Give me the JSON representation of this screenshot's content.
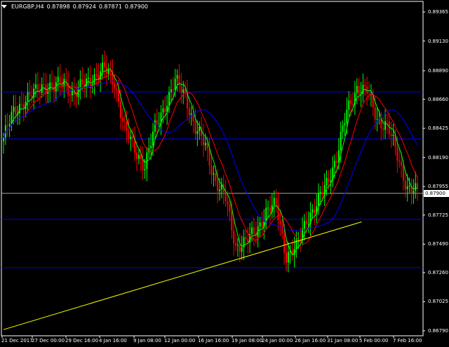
{
  "header": {
    "symbol": "EURGBP,H4",
    "open": "0.87898",
    "high": "0.87924",
    "low": "0.87871",
    "close": "0.87900"
  },
  "bid_label": "0.87900",
  "price_ticks": [
    "0.89365",
    "0.89130",
    "0.88890",
    "0.88660",
    "0.88425",
    "0.88190",
    "0.87955",
    "0.87725",
    "0.87490",
    "0.87260",
    "0.87025",
    "0.86790"
  ],
  "time_labels": [
    "21 Dec 2017",
    "27 Dec 00:00",
    "29 Dec 16:00",
    "4 Jan 16:00",
    "9 Jan 08:00",
    "12 Jan 00:00",
    "16 Jan 16:00",
    "19 Jan 08:00",
    "24 Jan 00:00",
    "26 Jan 16:00",
    "31 Jan 08:00",
    "5 Feb 00:00",
    "7 Feb 16:00"
  ],
  "colors": {
    "background": "#000000",
    "bull": "#00ff00",
    "bear": "#ff0000",
    "ma_fast": "#00ff00",
    "ma_mid": "#ff0000",
    "ma_slow": "#0000ff",
    "hline": "#0000ff",
    "bid_line": "#c0c0c0",
    "trendline": "#ffff00",
    "text": "#ffffff"
  },
  "chart_data": {
    "type": "candlestick",
    "symbol": "EURGBP",
    "timeframe": "H4",
    "ylim": [
      0.8675,
      0.8945
    ],
    "horizontal_levels": [
      0.8872,
      0.8834,
      0.8769,
      0.873
    ],
    "bid_level": 0.879,
    "trendline": {
      "from": [
        0,
        0.868
      ],
      "to": [
        160,
        0.8761
      ]
    },
    "close_path": [
      [
        0,
        0.8835
      ],
      [
        5,
        0.8855
      ],
      [
        10,
        0.8865
      ],
      [
        15,
        0.887
      ],
      [
        20,
        0.8878
      ],
      [
        25,
        0.8875
      ],
      [
        30,
        0.888
      ],
      [
        35,
        0.887
      ],
      [
        40,
        0.8878
      ],
      [
        45,
        0.8885
      ],
      [
        50,
        0.889
      ],
      [
        55,
        0.888
      ],
      [
        60,
        0.8842
      ],
      [
        65,
        0.8825
      ],
      [
        70,
        0.8813
      ],
      [
        75,
        0.8842
      ],
      [
        80,
        0.8862
      ],
      [
        85,
        0.888
      ],
      [
        90,
        0.887
      ],
      [
        95,
        0.8842
      ],
      [
        100,
        0.8828
      ],
      [
        105,
        0.88
      ],
      [
        110,
        0.8785
      ],
      [
        115,
        0.8748
      ],
      [
        120,
        0.875
      ],
      [
        125,
        0.876
      ],
      [
        130,
        0.8775
      ],
      [
        135,
        0.878
      ],
      [
        140,
        0.874
      ],
      [
        145,
        0.8745
      ],
      [
        150,
        0.877
      ],
      [
        155,
        0.878
      ],
      [
        160,
        0.8798
      ],
      [
        165,
        0.882
      ],
      [
        170,
        0.8855
      ],
      [
        175,
        0.8876
      ],
      [
        180,
        0.8872
      ],
      [
        185,
        0.885
      ],
      [
        190,
        0.8845
      ],
      [
        195,
        0.882
      ],
      [
        200,
        0.8795
      ],
      [
        205,
        0.879
      ]
    ]
  }
}
